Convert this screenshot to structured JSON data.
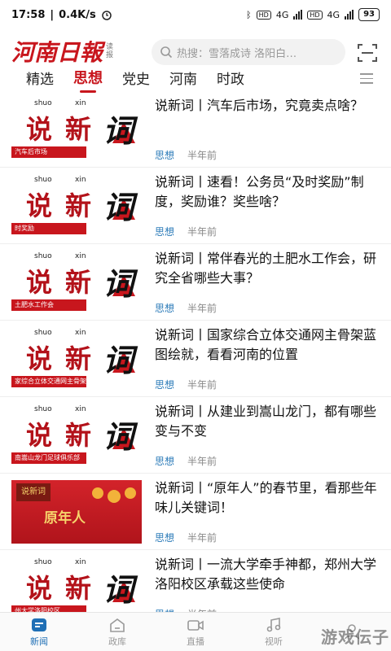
{
  "status_bar": {
    "time": "17:58",
    "speed": "0.4K/s",
    "net1": "4G",
    "net2": "4G",
    "hd": "HD",
    "battery": "93"
  },
  "header": {
    "logo_text": "河南日報",
    "logo_sub": "读报",
    "search_placeholder": "热搜：雪落成诗 洛阳白…"
  },
  "tabs": [
    {
      "label": "精选",
      "active": false
    },
    {
      "label": "思想",
      "active": true
    },
    {
      "label": "党史",
      "active": false
    },
    {
      "label": "河南",
      "active": false
    },
    {
      "label": "时政",
      "active": false
    }
  ],
  "thumb_text": {
    "pinyin1": "shuo",
    "pinyin2": "xin",
    "char1": "说",
    "char2": "新",
    "char3": "词"
  },
  "articles": [
    {
      "title": "说新词丨汽车后市场，究竟卖点啥？",
      "category": "思想",
      "time": "半年前",
      "band": "汽车后市场"
    },
    {
      "title": "说新词丨速看！公务员“及时奖励”制度，奖励谁？奖些啥？",
      "category": "思想",
      "time": "半年前",
      "band": "时奖励"
    },
    {
      "title": "说新词丨常伴春光的土肥水工作会，研究全省哪些大事？",
      "category": "思想",
      "time": "半年前",
      "band": "土肥水工作会"
    },
    {
      "title": "说新词丨国家综合立体交通网主骨架蓝图绘就，看看河南的位置",
      "category": "思想",
      "time": "半年前",
      "band": "家综合立体交通网主骨架"
    },
    {
      "title": "说新词丨从建业到嵩山龙门，都有哪些变与不变",
      "category": "思想",
      "time": "半年前",
      "band": "南嵩山龙门足球俱乐部"
    },
    {
      "title": "说新词丨“原年人”的春节里，看那些年味儿关键词！",
      "category": "思想",
      "time": "半年前",
      "photo_text": "原年人",
      "photo_mini": "说新词"
    },
    {
      "title": "说新词丨一流大学牵手神都，郑州大学洛阳校区承载这些使命",
      "category": "思想",
      "time": "半年前",
      "band": "州大学洛阳校区"
    }
  ],
  "bottom_nav": [
    {
      "label": "新闻",
      "icon": "news-icon",
      "active": true
    },
    {
      "label": "政库",
      "icon": "home-icon",
      "active": false
    },
    {
      "label": "直播",
      "icon": "video-icon",
      "active": false
    },
    {
      "label": "视听",
      "icon": "music-icon",
      "active": false
    },
    {
      "label": "",
      "icon": "user-icon",
      "active": false
    }
  ],
  "watermark": "游戏伝子",
  "colors": {
    "brand": "#c8161d",
    "category": "#2a7ab8",
    "nav_active": "#1f6fb5"
  }
}
